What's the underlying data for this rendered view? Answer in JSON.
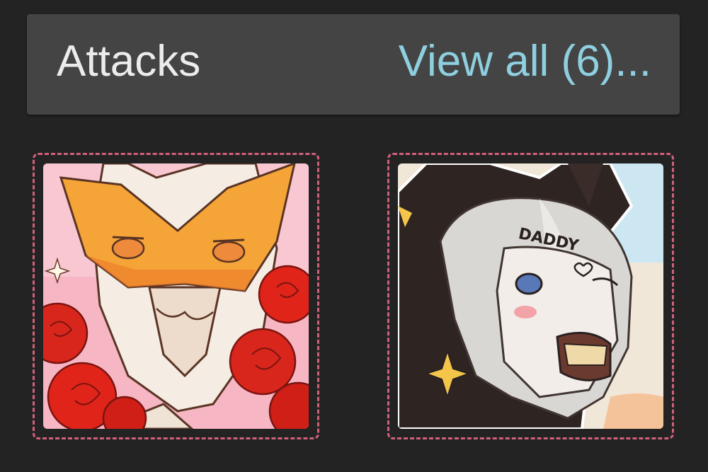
{
  "section": {
    "title": "Attacks",
    "view_all_label": "View all (6)..."
  },
  "attacks": [
    {
      "item": "attack-thumbnail-1",
      "art_icon": "masked-white-character-with-roses-icon"
    },
    {
      "item": "attack-thumbnail-2",
      "art_icon": "white-haired-horned-character-icon",
      "art_text": "DADDY"
    }
  ],
  "colors": {
    "background": "#232323",
    "header_bg": "#444444",
    "title_text": "#ececec",
    "link_text": "#8ecfe0",
    "thumbnail_border": "#d0607a"
  }
}
